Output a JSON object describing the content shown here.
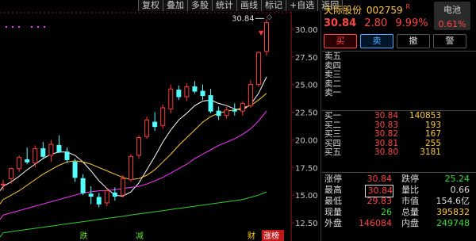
{
  "toolbar": [
    "复权",
    "叠加",
    "多股",
    "统计",
    "画线",
    "标记",
    "+自选",
    "返回"
  ],
  "chart_data": {
    "type": "candlestick",
    "ylim": [
      12.0,
      31.5
    ],
    "y_ticks": [
      "30.00",
      "27.50",
      "25.00",
      "22.50",
      "20.00",
      "17.50",
      "15.00",
      "12.50"
    ],
    "y_tick_values": [
      30.0,
      27.5,
      25.0,
      22.5,
      20.0,
      17.5,
      15.0,
      12.5
    ],
    "candles": [
      {
        "o": 16.0,
        "h": 16.4,
        "l": 15.4,
        "c": 16.0
      },
      {
        "o": 16.5,
        "h": 17.5,
        "l": 16.0,
        "c": 17.4
      },
      {
        "o": 17.4,
        "h": 18.6,
        "l": 17.1,
        "c": 18.4
      },
      {
        "o": 18.2,
        "h": 19.3,
        "l": 17.8,
        "c": 18.0
      },
      {
        "o": 17.9,
        "h": 19.5,
        "l": 17.5,
        "c": 19.2
      },
      {
        "o": 19.2,
        "h": 19.8,
        "l": 18.3,
        "c": 18.5
      },
      {
        "o": 18.6,
        "h": 20.0,
        "l": 18.0,
        "c": 19.6
      },
      {
        "o": 19.5,
        "h": 20.4,
        "l": 18.8,
        "c": 18.9
      },
      {
        "o": 18.9,
        "h": 19.3,
        "l": 17.9,
        "c": 18.2
      },
      {
        "o": 18.0,
        "h": 18.3,
        "l": 16.2,
        "c": 16.6
      },
      {
        "o": 16.5,
        "h": 16.9,
        "l": 15.0,
        "c": 15.2
      },
      {
        "o": 15.1,
        "h": 15.8,
        "l": 14.2,
        "c": 14.9
      },
      {
        "o": 14.8,
        "h": 15.2,
        "l": 13.9,
        "c": 14.2
      },
      {
        "o": 14.3,
        "h": 15.6,
        "l": 14.0,
        "c": 15.4
      },
      {
        "o": 15.2,
        "h": 15.7,
        "l": 14.5,
        "c": 14.9
      },
      {
        "o": 15.0,
        "h": 16.8,
        "l": 14.8,
        "c": 16.5
      },
      {
        "o": 16.4,
        "h": 18.7,
        "l": 16.2,
        "c": 18.5
      },
      {
        "o": 18.6,
        "h": 20.4,
        "l": 18.3,
        "c": 20.2
      },
      {
        "o": 20.3,
        "h": 22.1,
        "l": 20.1,
        "c": 21.8
      },
      {
        "o": 21.6,
        "h": 22.5,
        "l": 20.8,
        "c": 21.2
      },
      {
        "o": 21.3,
        "h": 23.2,
        "l": 21.0,
        "c": 22.9
      },
      {
        "o": 22.8,
        "h": 25.0,
        "l": 22.4,
        "c": 24.6
      },
      {
        "o": 24.5,
        "h": 24.9,
        "l": 23.6,
        "c": 23.9
      },
      {
        "o": 23.9,
        "h": 25.1,
        "l": 23.5,
        "c": 24.8
      },
      {
        "o": 24.8,
        "h": 25.3,
        "l": 24.2,
        "c": 24.4
      },
      {
        "o": 24.4,
        "h": 25.0,
        "l": 23.6,
        "c": 24.0
      },
      {
        "o": 24.0,
        "h": 24.6,
        "l": 22.4,
        "c": 22.6
      },
      {
        "o": 22.6,
        "h": 23.0,
        "l": 21.8,
        "c": 22.2
      },
      {
        "o": 22.2,
        "h": 23.0,
        "l": 21.9,
        "c": 22.7
      },
      {
        "o": 22.7,
        "h": 23.3,
        "l": 22.2,
        "c": 22.6
      },
      {
        "o": 22.6,
        "h": 23.5,
        "l": 22.2,
        "c": 23.3
      },
      {
        "o": 23.1,
        "h": 25.4,
        "l": 22.9,
        "c": 25.0
      },
      {
        "o": 25.0,
        "h": 28.0,
        "l": 24.8,
        "c": 27.9
      },
      {
        "o": 28.0,
        "h": 30.9,
        "l": 27.6,
        "c": 30.6
      }
    ],
    "ma_lines": [
      {
        "name": "MA5",
        "color": "#ffffff",
        "values": [
          15.8,
          16.2,
          16.7,
          17.3,
          17.8,
          18.3,
          18.7,
          18.9,
          18.9,
          18.6,
          18.0,
          17.2,
          16.3,
          15.6,
          15.0,
          14.9,
          15.3,
          16.1,
          17.3,
          18.5,
          19.8,
          20.9,
          21.8,
          22.4,
          23.1,
          23.5,
          23.6,
          23.3,
          23.1,
          22.8,
          22.7,
          23.2,
          24.2,
          25.7
        ]
      },
      {
        "name": "MA10",
        "color": "#ffcc33",
        "values": [
          14.6,
          15.0,
          15.4,
          15.9,
          16.4,
          16.9,
          17.3,
          17.7,
          18.0,
          18.1,
          18.0,
          17.8,
          17.5,
          17.2,
          16.9,
          16.6,
          16.4,
          16.5,
          16.8,
          17.3,
          18.0,
          18.7,
          19.5,
          20.2,
          20.9,
          21.6,
          22.1,
          22.4,
          22.6,
          22.7,
          22.9,
          23.1,
          23.6,
          24.2
        ]
      },
      {
        "name": "MA20",
        "color": "#ff33ff",
        "values": [
          13.2,
          13.4,
          13.6,
          13.8,
          14.0,
          14.2,
          14.4,
          14.6,
          14.8,
          15.0,
          15.2,
          15.3,
          15.4,
          15.4,
          15.5,
          15.6,
          15.7,
          15.8,
          16.0,
          16.3,
          16.6,
          17.0,
          17.4,
          17.8,
          18.3,
          18.7,
          19.1,
          19.5,
          19.8,
          20.1,
          20.5,
          21.0,
          21.7,
          22.6
        ]
      },
      {
        "name": "MA60",
        "color": "#33cc33",
        "values": [
          11.6,
          11.7,
          11.8,
          11.9,
          12.0,
          12.1,
          12.2,
          12.3,
          12.4,
          12.5,
          12.6,
          12.7,
          12.8,
          12.9,
          13.0,
          13.1,
          13.2,
          13.3,
          13.4,
          13.5,
          13.6,
          13.7,
          13.8,
          13.9,
          14.0,
          14.1,
          14.2,
          14.3,
          14.4,
          14.5,
          14.6,
          14.8,
          15.0,
          15.3
        ]
      }
    ],
    "annotations": {
      "max_label": "30.84",
      "bottom_marks": [
        {
          "text": "跌",
          "index": 10
        },
        {
          "text": "减",
          "index": 17
        },
        {
          "text": "财",
          "index": 31
        },
        {
          "text": "涨榜",
          "index": 33
        }
      ]
    }
  },
  "quote": {
    "name": "天际股份",
    "code": "002759",
    "r_mark": "R",
    "price": "30.84",
    "change": "2.80",
    "change_pct": "9.99%",
    "badge_label": "电池",
    "badge_value": "0.61%"
  },
  "buttons": {
    "buy": "买",
    "sell": "卖",
    "cancel": "撤",
    "alert": "警"
  },
  "asks": [
    {
      "label": "卖五",
      "price": "",
      "vol": ""
    },
    {
      "label": "卖四",
      "price": "",
      "vol": ""
    },
    {
      "label": "卖三",
      "price": "",
      "vol": ""
    },
    {
      "label": "卖二",
      "price": "",
      "vol": ""
    },
    {
      "label": "卖一",
      "price": "",
      "vol": ""
    }
  ],
  "bids": [
    {
      "label": "买一",
      "price": "30.84",
      "vol": "140853"
    },
    {
      "label": "买二",
      "price": "30.83",
      "vol": "193"
    },
    {
      "label": "买三",
      "price": "30.82",
      "vol": "167"
    },
    {
      "label": "买四",
      "price": "30.81",
      "vol": "255"
    },
    {
      "label": "买五",
      "price": "30.80",
      "vol": "3181"
    }
  ],
  "stats": {
    "limit_up_label": "涨停",
    "limit_up": "30.84",
    "limit_down_label": "跌停",
    "limit_down": "25.24",
    "high_label": "最高",
    "high": "30.84",
    "vol_ratio_label": "量比",
    "vol_ratio": "0.66",
    "low_label": "最低",
    "low": "29.83",
    "turnover_label": "市值",
    "turnover": "154.6亿",
    "now_vol_label": "现量",
    "now_vol": "26",
    "total_vol_label": "总量",
    "total_vol": "395832",
    "outer_label": "外盘",
    "outer": "146084",
    "inner_label": "内盘",
    "inner": "249748"
  }
}
